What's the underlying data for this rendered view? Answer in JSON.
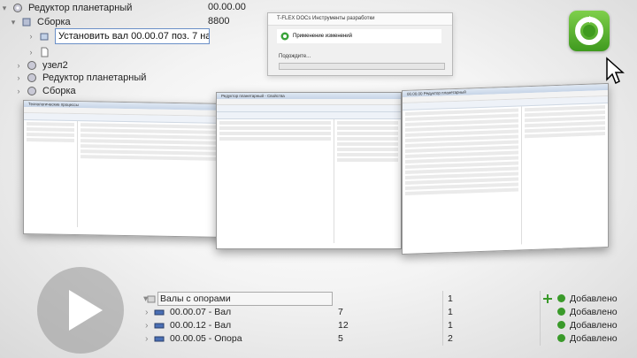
{
  "top_tree": {
    "rows": [
      {
        "label": "Редуктор планетарный",
        "value": "00.00.00"
      },
      {
        "label": "Сборка",
        "value": "8800"
      },
      {
        "label": "Установить вал 00.00.07 поз. 7 на ..."
      },
      {
        "label": ""
      },
      {
        "label": "узел2"
      },
      {
        "label": "Редуктор планетарный"
      },
      {
        "label": "Сборка"
      }
    ]
  },
  "dialog": {
    "title": "T-FLEX DOCs Инструменты разработки",
    "header": "Применение изменений",
    "message": "Подождите..."
  },
  "cards": {
    "card1_title": "Технологические процессы",
    "card2_title": "Редуктор планетарный - Свойства",
    "card3_title": "00.00.00 Редуктор планетарный"
  },
  "bottom_table": {
    "header": {
      "label": "Валы с опорами",
      "qty": "1",
      "status": "Добавлено"
    },
    "rows": [
      {
        "label": "00.00.07 - Вал",
        "pos": "7",
        "qty": "1",
        "status": "Добавлено"
      },
      {
        "label": "00.00.12 - Вал",
        "pos": "12",
        "qty": "1",
        "status": "Добавлено"
      },
      {
        "label": "00.00.05 - Опора",
        "pos": "5",
        "qty": "2",
        "status": "Добавлено"
      }
    ]
  },
  "colors": {
    "accent": "#3f9a1f",
    "selection": "#6a8fc7"
  }
}
